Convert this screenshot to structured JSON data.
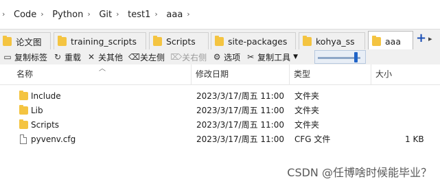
{
  "address_bar": {
    "crumbs": [
      "Code",
      "Python",
      "Git",
      "test1",
      "aaa"
    ]
  },
  "tabs": [
    {
      "label": "论文图"
    },
    {
      "label": "training_scripts"
    },
    {
      "label": "Scripts"
    },
    {
      "label": "site-packages"
    },
    {
      "label": "kohya_ss"
    },
    {
      "label": "aaa"
    }
  ],
  "toolbar": {
    "copy_tab": "复制标签",
    "reload": "重载",
    "close_others": "关其他",
    "close_left": "关左侧",
    "close_right": "关右侧",
    "options": "选项",
    "copy_tools": "复制工具"
  },
  "columns": {
    "name": "名称",
    "modified": "修改日期",
    "type": "类型",
    "size": "大小"
  },
  "files": [
    {
      "name": "Include",
      "modified": "2023/3/17/周五 11:00",
      "type": "文件夹",
      "size": "",
      "icon": "folder-icon"
    },
    {
      "name": "Lib",
      "modified": "2023/3/17/周五 11:00",
      "type": "文件夹",
      "size": "",
      "icon": "folder-icon"
    },
    {
      "name": "Scripts",
      "modified": "2023/3/17/周五 11:00",
      "type": "文件夹",
      "size": "",
      "icon": "folder-icon"
    },
    {
      "name": "pyvenv.cfg",
      "modified": "2023/3/17/周五 11:00",
      "type": "CFG 文件",
      "size": "1 KB",
      "icon": "file-icon"
    }
  ],
  "zoom_slider": {
    "level": 0.9
  },
  "watermark": "CSDN @任博啥时候能毕业？"
}
